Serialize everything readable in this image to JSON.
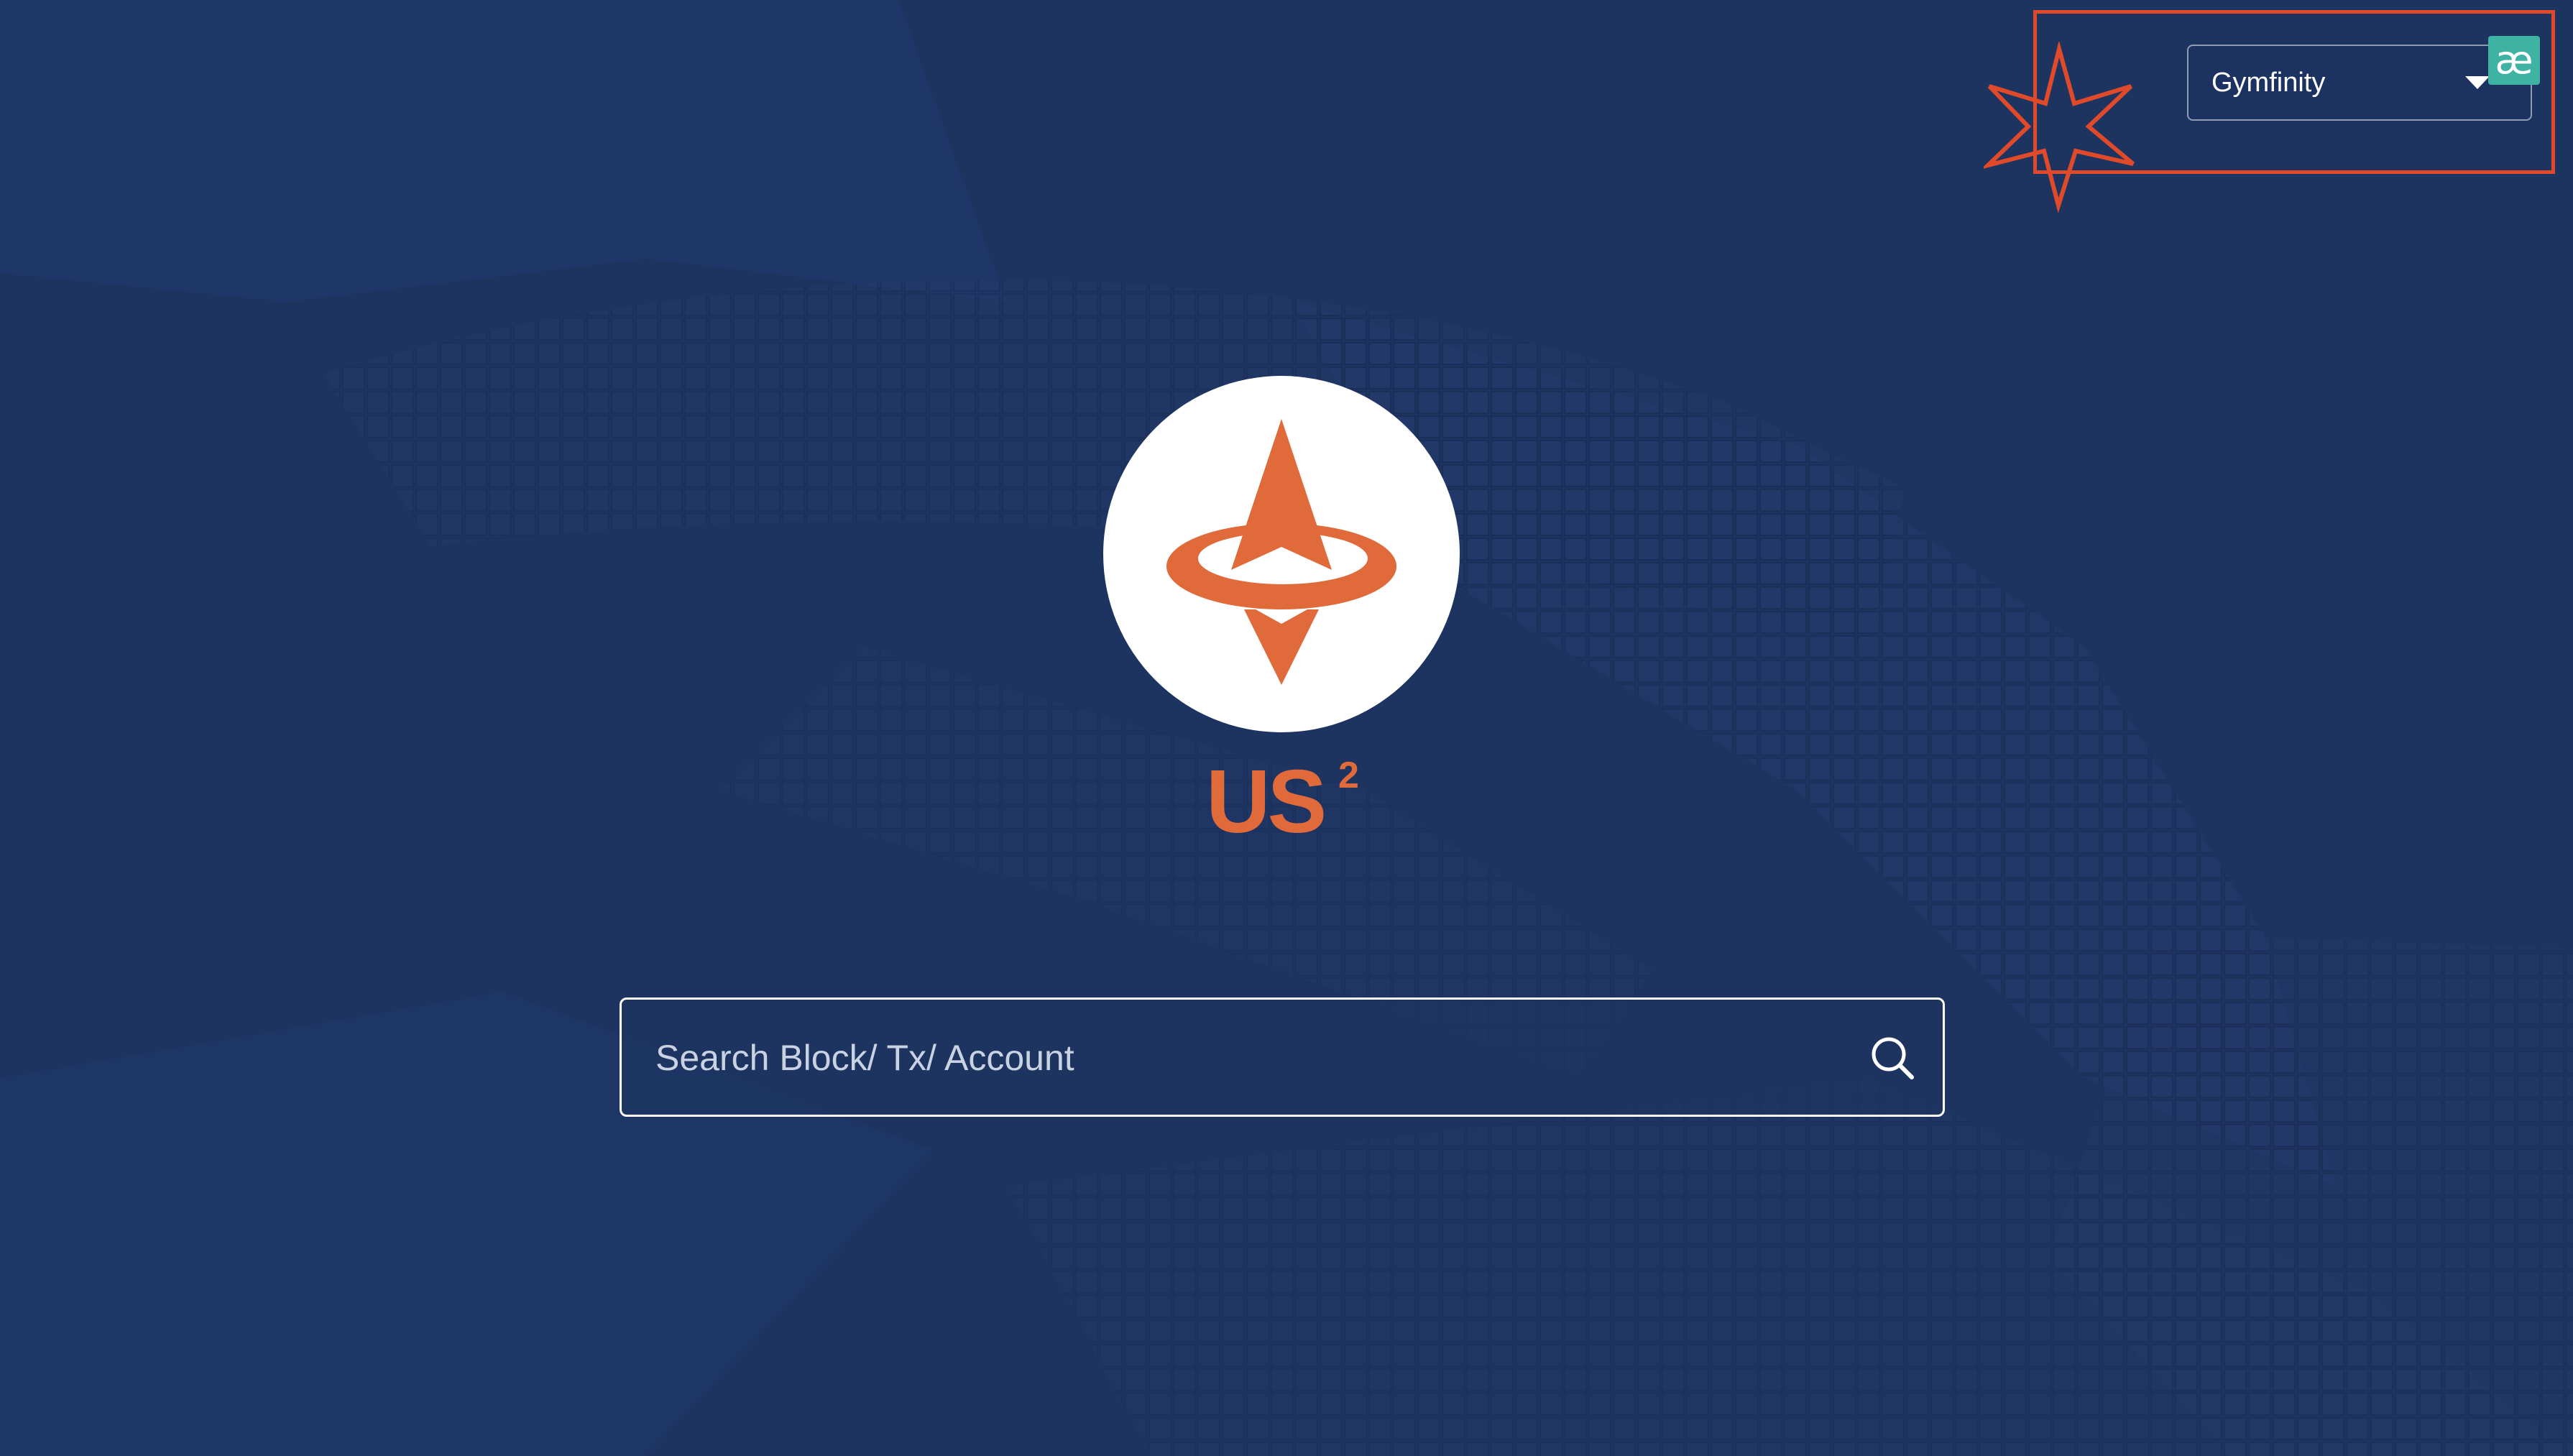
{
  "network_selector": {
    "selected": "Gymfinity",
    "extension_badge": "æ"
  },
  "logo": {
    "wordmark": "US",
    "superscript": "2"
  },
  "search": {
    "placeholder": "Search Block/ Tx/ Account"
  },
  "colors": {
    "background": "#1d3461",
    "accent": "#e06a3a",
    "highlight": "#e04a2a",
    "badge": "#3fb3a3"
  },
  "icons": {
    "search": "search-icon",
    "caret": "chevron-down-icon",
    "star": "star-icon",
    "badge": "extension-icon"
  }
}
